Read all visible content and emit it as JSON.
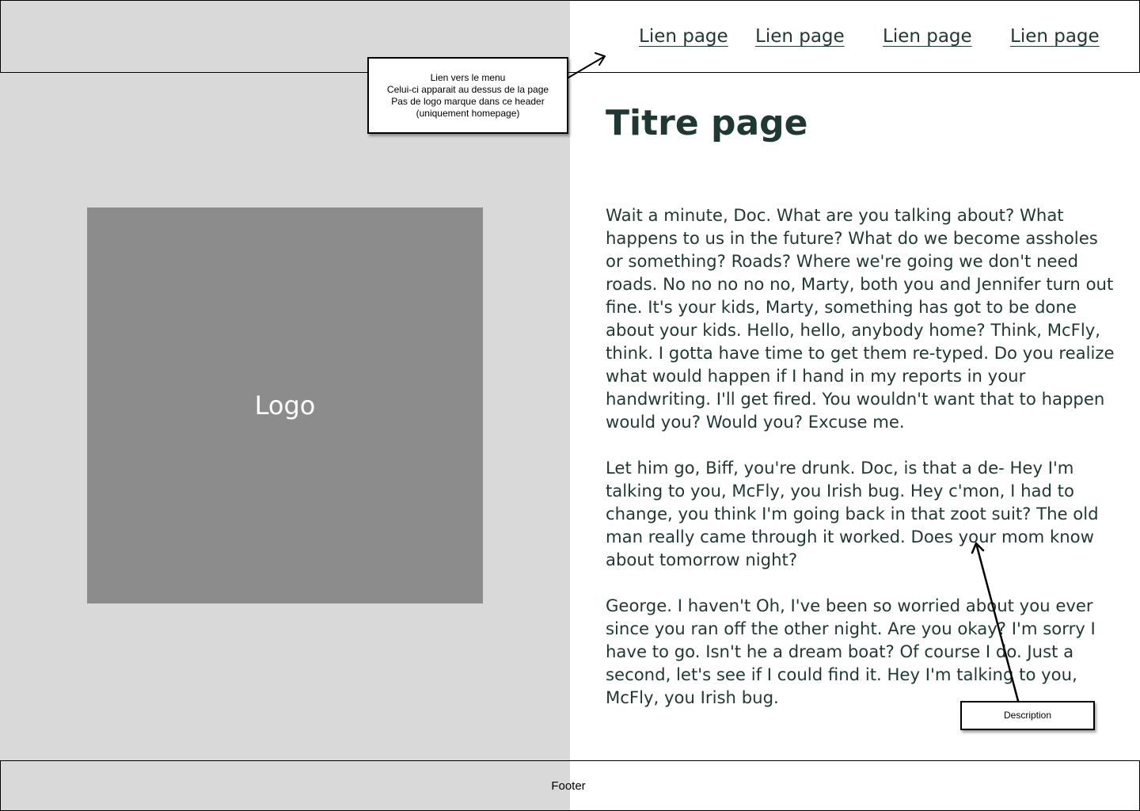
{
  "header": {
    "nav_links": [
      "Lien page",
      "Lien page",
      "Lien page",
      "Lien page"
    ]
  },
  "annotations": {
    "menu_note": [
      "Lien vers le menu",
      "Celui-ci apparait au dessus de la page",
      "Pas de logo marque dans ce header",
      "(uniquement homepage)"
    ],
    "description_note": "Description"
  },
  "logo": {
    "label": "Logo"
  },
  "main": {
    "title": "Titre page",
    "paragraphs": [
      "Wait a minute, Doc. What are you talking about? What happens to us in the future? What do we become assholes or something? Roads? Where we're going we don't need roads. No no no no no, Marty, both you and Jennifer turn out fine. It's your kids, Marty, something has got to be done about your kids. Hello, hello, anybody home? Think, McFly, think. I gotta have time to get them re-typed. Do you realize what would happen if I hand in my reports in your handwriting. I'll get fired. You wouldn't want that to happen would you? Would you? Excuse me.",
      "Let him go, Biff, you're drunk. Doc, is that a de- Hey I'm talking to you, McFly, you Irish bug. Hey c'mon, I had to change, you think I'm going back in that zoot suit? The old man really came through it worked. Does your mom know about tomorrow night?",
      "George. I haven't Oh, I've been so worried about you ever since you ran off the other night. Are you okay? I'm sorry I have to go. Isn't he a dream boat? Of course I do. Just a second, let's see if I could find it. Hey I'm talking to you, McFly, you Irish bug."
    ]
  },
  "footer": {
    "label": "Footer"
  },
  "colors": {
    "left_panel": "#d9d9d9",
    "logo_box": "#8c8c8c",
    "text": "#1f3833"
  }
}
